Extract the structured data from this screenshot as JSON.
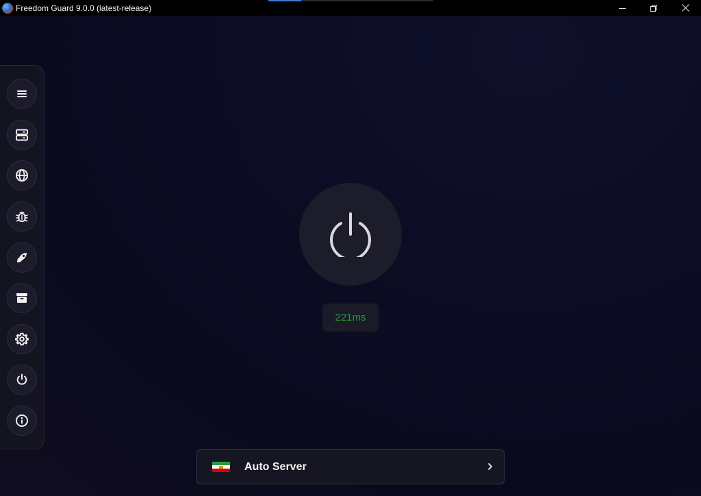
{
  "window": {
    "title": "Freedom Guard 9.0.0 (latest-release)",
    "minimize_icon": "minimize-icon",
    "restore_icon": "restore-icon",
    "close_icon": "close-icon",
    "loading_progress": 0.2
  },
  "sidebar": {
    "items": [
      {
        "name": "menu",
        "icon": "menu-icon"
      },
      {
        "name": "servers",
        "icon": "server-icon"
      },
      {
        "name": "browser",
        "icon": "globe-icon"
      },
      {
        "name": "debug",
        "icon": "bug-icon"
      },
      {
        "name": "tools",
        "icon": "rocket-icon"
      },
      {
        "name": "archive",
        "icon": "archive-icon"
      },
      {
        "name": "settings",
        "icon": "gear-icon"
      },
      {
        "name": "power",
        "icon": "power-icon"
      },
      {
        "name": "about",
        "icon": "info-icon"
      }
    ]
  },
  "main": {
    "power_icon": "power-icon",
    "ping": "221ms"
  },
  "server": {
    "flag_icon": "iran-flag-icon",
    "label": "Auto Server",
    "chevron_icon": "chevron-right-icon"
  },
  "colors": {
    "background": "#0b0c22",
    "sidebar": "#141421",
    "ping_text": "#1e9e2a",
    "accent": "#3a7bd5"
  }
}
